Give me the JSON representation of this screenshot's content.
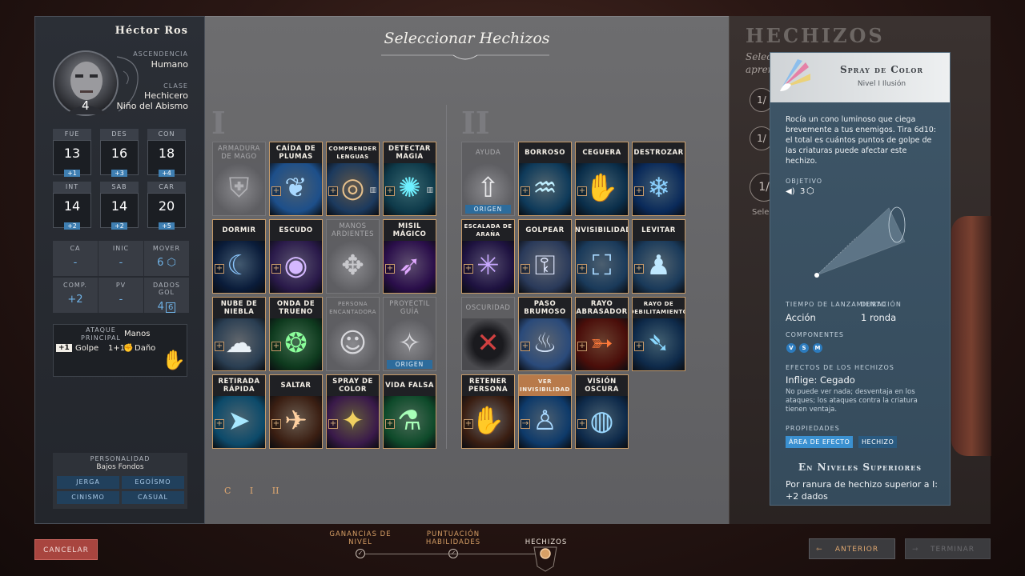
{
  "character": {
    "name": "Héctor Ros",
    "level": "4",
    "ancestry_label": "ASCENDENCIA",
    "ancestry": "Humano",
    "class_label": "CLASE",
    "class": "Hechicero",
    "subclass": "Niño del Abismo",
    "stats": [
      {
        "label": "FUE",
        "value": "13",
        "mod": "+1"
      },
      {
        "label": "DES",
        "value": "16",
        "mod": "+3"
      },
      {
        "label": "CON",
        "value": "18",
        "mod": "+4"
      },
      {
        "label": "INT",
        "value": "14",
        "mod": "+2"
      },
      {
        "label": "SAB",
        "value": "14",
        "mod": "+2"
      },
      {
        "label": "CAR",
        "value": "20",
        "mod": "+5"
      }
    ],
    "derived": [
      {
        "label": "CA",
        "value": "-"
      },
      {
        "label": "INIC",
        "value": "-"
      },
      {
        "label": "MOVER",
        "value": "6"
      },
      {
        "label": "COMP.",
        "value": "+2"
      },
      {
        "label": "PV",
        "value": "-"
      },
      {
        "label": "DADOS GOL",
        "value": "4",
        "extra": "6"
      }
    ],
    "attack": {
      "label": "ATAQUE PRINCIPAL",
      "weapon": "Manos",
      "bonus": "+1",
      "type": "Golpe",
      "damage": "1+1",
      "damage_label": "Daño"
    },
    "personality": {
      "label": "PERSONALIDAD",
      "background": "Bajos Fondos",
      "tags": [
        "JERGA",
        "EGOÍSMO",
        "CINISMO",
        "CASUAL"
      ]
    }
  },
  "selection": {
    "title": "Seleccionar Hechizos",
    "level1_numeral": "I",
    "level2_numeral": "II",
    "level1_spells": [
      {
        "name": "ARMADURA DE MAGO",
        "state": "dim",
        "art": "armor"
      },
      {
        "name": "CAÍDA DE PLUMAS",
        "state": "active",
        "art": "feather"
      },
      {
        "name": "COMPRENDER LENGUAS",
        "state": "active",
        "art": "ear",
        "book": true
      },
      {
        "name": "DETECTAR MAGIA",
        "state": "active",
        "art": "orb",
        "book": true
      },
      {
        "name": "DORMIR",
        "state": "active",
        "art": "sleep"
      },
      {
        "name": "ESCUDO",
        "state": "active",
        "art": "shield"
      },
      {
        "name": "MANOS ARDIENTES",
        "state": "dim",
        "art": "hands"
      },
      {
        "name": "MISIL MÁGICO",
        "state": "active",
        "art": "missile"
      },
      {
        "name": "NUBE DE NIEBLA",
        "state": "active",
        "art": "fog"
      },
      {
        "name": "ONDA DE TRUENO",
        "state": "active",
        "art": "thunder"
      },
      {
        "name": "PERSONA ENCANTADORA",
        "state": "dim",
        "art": "person"
      },
      {
        "name": "PROYECTIL GUÍA",
        "state": "dim",
        "art": "bolt",
        "origin": "ORIGEN"
      },
      {
        "name": "RETIRADA RÁPIDA",
        "state": "active",
        "art": "run"
      },
      {
        "name": "SALTAR",
        "state": "active",
        "art": "jump"
      },
      {
        "name": "SPRAY DE COLOR",
        "state": "active",
        "art": "spray"
      },
      {
        "name": "VIDA FALSA",
        "state": "active",
        "art": "potion"
      }
    ],
    "level2_spells": [
      {
        "name": "AYUDA",
        "state": "dim",
        "art": "aid",
        "origin": "ORIGEN"
      },
      {
        "name": "BORROSO",
        "state": "active",
        "art": "blur"
      },
      {
        "name": "CEGUERA",
        "state": "active",
        "art": "blind"
      },
      {
        "name": "DESTROZAR",
        "state": "active",
        "art": "shatter"
      },
      {
        "name": "ESCALADA DE ARAÑA",
        "state": "active",
        "art": "spider"
      },
      {
        "name": "GOLPEAR",
        "state": "active",
        "art": "knock"
      },
      {
        "name": "INVISIBILIDAD",
        "state": "active",
        "art": "invis"
      },
      {
        "name": "LEVITAR",
        "state": "active",
        "art": "levitate"
      },
      {
        "name": "OSCURIDAD",
        "state": "dim",
        "art": "dark",
        "blocked": true
      },
      {
        "name": "PASO BRUMOSO",
        "state": "active",
        "art": "misty"
      },
      {
        "name": "RAYO ABRASADOR",
        "state": "active",
        "art": "ray"
      },
      {
        "name": "RAYO DE DEBILITAMIENTO",
        "state": "active",
        "art": "weak"
      },
      {
        "name": "RETENER PERSONA",
        "state": "active",
        "art": "hold"
      },
      {
        "name": "VER INVISIBILIDAD",
        "state": "active",
        "art": "see",
        "highlight": true
      },
      {
        "name": "VISIÓN OSCURA",
        "state": "active",
        "art": "darkvision"
      }
    ],
    "pager": [
      "C",
      "I",
      "II"
    ]
  },
  "spells_panel": {
    "title": "HECHIZOS",
    "subtitle_1": "Selecc",
    "subtitle_2": "apren",
    "slot_text": "1/",
    "select_label": "Sele"
  },
  "tooltip": {
    "name": "Spray de Color",
    "subtitle": "Nivel I Ilusión",
    "description": "Rocía un cono luminoso que ciega brevemente a tus enemigos. Tira 6d10: el total es cuántos puntos de golpe de las criaturas puede afectar este hechizo.",
    "target_label": "OBJETIVO",
    "target_value": "3",
    "cast_time_label": "TIEMPO DE LANZAMIENTO",
    "cast_time": "Acción",
    "duration_label": "DURACIÓN",
    "duration": "1 ronda",
    "components_label": "COMPONENTES",
    "components": [
      "V",
      "S",
      "M"
    ],
    "effects_label": "EFECTOS DE LOS HECHIZOS",
    "effect_name": "Inflige: Cegado",
    "effect_desc": "No puede ver nada; desventaja en los ataques; los ataques contra la criatura tienen ventaja.",
    "properties_label": "PROPIEDADES",
    "properties": [
      "ÁREA DE EFECTO",
      "HECHIZO"
    ],
    "higher_title": "En Niveles Superiores",
    "higher_desc": "Por ranura de hechizo superior a I: +2 dados"
  },
  "footer": {
    "cancel": "CANCELAR",
    "steps": [
      {
        "label": "GANANCIAS DE NIVEL",
        "done": true
      },
      {
        "label": "PUNTUACIÓN HABILIDADES",
        "done": true
      },
      {
        "label": "HECHIZOS",
        "current": true
      }
    ],
    "back": "ANTERIOR",
    "finish": "TERMINAR"
  },
  "colors": {
    "accent_orange": "#d8a066",
    "card_border": "#c69a67",
    "mod_blue": "#3f7fb2",
    "tooltip_bg": "#3e5668",
    "origin_blue": "#2d6c9c"
  }
}
